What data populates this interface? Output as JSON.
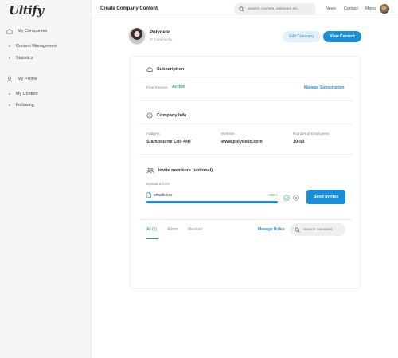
{
  "app": {
    "logo": "Ultify"
  },
  "sidebar": {
    "sections": [
      {
        "label": "My Companies",
        "icon": "home-icon",
        "items": [
          "Content Management",
          "Statistics"
        ]
      },
      {
        "label": "My Profile",
        "icon": "user-icon",
        "items": [
          "My Content",
          "Following"
        ]
      }
    ]
  },
  "topbar": {
    "title": "Create Company Content",
    "search_placeholder": "Search courses, webinars etc...",
    "links": [
      "News",
      "Contact",
      "Menu"
    ]
  },
  "company": {
    "name": "Polydelic",
    "category": "IT Community",
    "edit_label": "Edit Company",
    "view_label": "View Content"
  },
  "subscription": {
    "heading": "Subscription",
    "plan_label": "Free Forever",
    "status": "Active",
    "manage_label": "Manage Subscription"
  },
  "company_info": {
    "heading": "Company Info",
    "fields": [
      {
        "label": "Address",
        "value": "Stambourne C09 4NT"
      },
      {
        "label": "Website",
        "value": "www.polydelic.com"
      },
      {
        "label": "Number of Employees",
        "value": "10-50"
      }
    ]
  },
  "invite": {
    "heading": "Invite members (optional)",
    "upload_label": "Upload a CSV",
    "file_name": "emails.csv",
    "progress_text": "100%",
    "progress": 100,
    "send_label": "Send invites"
  },
  "members": {
    "tabs": [
      "All (1)",
      "Admin",
      "Member"
    ],
    "manage_roles_label": "Manage Roles",
    "search_placeholder": "Search members"
  },
  "colors": {
    "accent": "#1a8fd9",
    "success": "#2fb06a"
  }
}
